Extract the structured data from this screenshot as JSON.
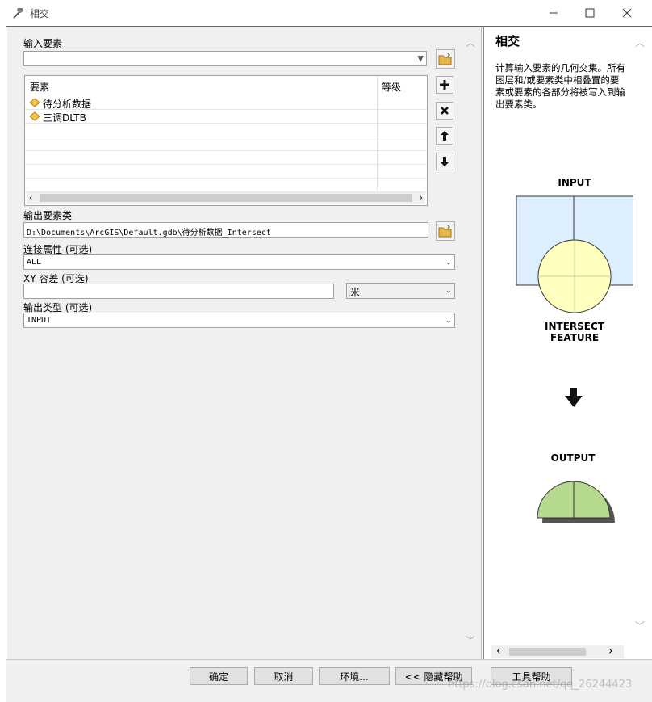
{
  "window": {
    "title": "相交"
  },
  "form": {
    "input_features_label": "输入要素",
    "table": {
      "col_features": "要素",
      "col_rank": "等级",
      "rows": [
        {
          "name": "待分析数据"
        },
        {
          "name": "三调DLTB"
        }
      ]
    },
    "output_label": "输出要素类",
    "output_value": "D:\\Documents\\ArcGIS\\Default.gdb\\待分析数据_Intersect",
    "join_label": "连接属性 (可选)",
    "join_value": "ALL",
    "xy_label": "XY 容差 (可选)",
    "xy_value": "",
    "xy_unit": "米",
    "outtype_label": "输出类型 (可选)",
    "outtype_value": "INPUT"
  },
  "help": {
    "title": "相交",
    "description": "计算输入要素的几何交集。所有图层和/或要素类中相叠置的要素或要素的各部分将被写入到输出要素类。",
    "diagram_input": "INPUT",
    "diagram_intersect_1": "INTERSECT",
    "diagram_intersect_2": "FEATURE",
    "diagram_output": "OUTPUT"
  },
  "buttons": {
    "ok": "确定",
    "cancel": "取消",
    "env": "环境...",
    "hide_help": "<< 隐藏帮助",
    "tool_help": "工具帮助"
  },
  "watermark": "https://blog.csdn.net/qq_26244423",
  "colors": {
    "input_fill": "#ddeeff",
    "intersect_fill": "#ffffc0",
    "output_fill": "#b5d98f",
    "feature_icon": "#f5c542"
  }
}
